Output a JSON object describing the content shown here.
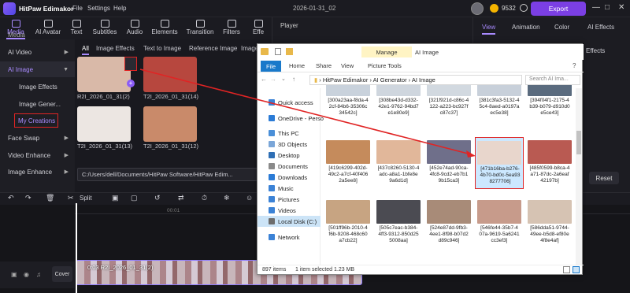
{
  "app": {
    "name": "HitPaw Edimakor",
    "menu": [
      "File",
      "Settings",
      "Help"
    ],
    "project_title": "2026-01-31_02",
    "coins": "9532",
    "export_label": "Export"
  },
  "toolbar": [
    "Media",
    "AI Avatar",
    "Text",
    "Subtitles",
    "Audio",
    "Elements",
    "Transition",
    "Filters",
    "Effe"
  ],
  "sidebar": {
    "top_partial": "Media",
    "items": [
      {
        "label": "AI Video"
      },
      {
        "label": "AI Image"
      },
      {
        "label": "Image Effects"
      },
      {
        "label": "Image Gener..."
      },
      {
        "label": "My Creations"
      },
      {
        "label": "Face Swap"
      },
      {
        "label": "Video Enhance"
      },
      {
        "label": "Image Enhance"
      }
    ]
  },
  "media": {
    "tabs": [
      "All",
      "Image Effects",
      "Text to Image",
      "Reference Image",
      "Image"
    ],
    "thumbs": [
      {
        "label": "R2I_2026_01_31(2)",
        "color": "#d9b9a8"
      },
      {
        "label": "T2I_2026_01_31(14)",
        "color": "#b7473e"
      },
      {
        "label": "T2I_2026_01_31(13)",
        "color": "#ece6e2"
      },
      {
        "label": "T2I_2026_01_31(12)",
        "color": "#c98a6a"
      }
    ],
    "path": "C:/Users/dell/Documents/HitPaw Software/HitPaw Edim..."
  },
  "player": {
    "label": "Player"
  },
  "right_panel": {
    "tabs": [
      "View",
      "Animation",
      "Color",
      "AI Effects"
    ],
    "subtab": "Effects",
    "reset_label": "Reset"
  },
  "timeline": {
    "split_label": "Split",
    "ruler_time": "00:01",
    "clip_label": "0:03 R2I_2026_01_31(2)",
    "cover_label": "Cover"
  },
  "explorer": {
    "manage_label": "Manage",
    "title": "AI Image",
    "ribbon": [
      "File",
      "Home",
      "Share",
      "View",
      "Picture Tools"
    ],
    "address": [
      "HitPaw Edimakor",
      "AI Generator",
      "AI Image"
    ],
    "search_placeholder": "Search AI Ima...",
    "nav": [
      {
        "label": "Quick access",
        "color": "#3b82d6"
      },
      {
        "label": "OneDrive - Perso",
        "color": "#2b7bd6"
      },
      {
        "label": "This PC",
        "color": "#4a8fd8"
      },
      {
        "label": "3D Objects",
        "color": "#7aa6d8"
      },
      {
        "label": "Desktop",
        "color": "#2f6fb5"
      },
      {
        "label": "Documents",
        "color": "#8a8a8a"
      },
      {
        "label": "Downloads",
        "color": "#2b7bd6"
      },
      {
        "label": "Music",
        "color": "#3b82d6"
      },
      {
        "label": "Pictures",
        "color": "#3b82d6"
      },
      {
        "label": "Videos",
        "color": "#3b82d6"
      },
      {
        "label": "Local Disk (C:)",
        "color": "#6c6c6c"
      },
      {
        "label": "Network",
        "color": "#3b82d6"
      }
    ],
    "files": [
      {
        "name": "[300a23aa-f8da-4 2cf-84b6-35306c 34542c]",
        "color": "#c9d2dc"
      },
      {
        "name": "[308be43d-d332- 42e1-9762-94bd7 e1e80e9]",
        "color": "#cfd6de"
      },
      {
        "name": "[321f921d-c86c-4 122-a223-bc927f c87c37]",
        "color": "#d2d9e0"
      },
      {
        "name": "[381c3fa3-5132-4 5c4-8aed-a0197a ec5e38]",
        "color": "#c8d0da"
      },
      {
        "name": "[394f04f1-2175-4 b39-b079-d910d0 e5ce43]",
        "color": "#5a6b7e"
      },
      {
        "name": "[419c6299-402d- 49c2-a7cf-40f406 2a5ee8]",
        "color": "#c58b5c"
      },
      {
        "name": "[437c8260-5130-4 adc-a8a1-1bfe8e 9a6d1d]",
        "color": "#e1b79a"
      },
      {
        "name": "[452e74ad-90ca- 4fc8-9cd2-eb7b1 9b15ca3]",
        "color": "#6f6f8a"
      },
      {
        "name": "[471b16ba-b276- 4b70-bd0c-5ea93 8277706]",
        "color": "#e8d6cc"
      },
      {
        "name": "[485f0599-b8ca-4 a71-87dc-2a6eaf 42197b]",
        "color": "#b95a52"
      },
      {
        "name": "[501ff96b-2010-4 f6b-9208-468c60 a7cb22]",
        "color": "#c7a482"
      },
      {
        "name": "[505c7eac-b384- 4ff3-9312-850d25 5008aa]",
        "color": "#4b4b52"
      },
      {
        "name": "[524e87dd-9fb3- 4ee1-8f98-b07d2 d89c946]",
        "color": "#a88b78"
      },
      {
        "name": "[546fe44-35b7-4 07a-9619-5a6241 cc3ef3]",
        "color": "#c79b8b"
      },
      {
        "name": "[586dda51-9744- 49ee-b5d8-ef80e 4f8e4af]",
        "color": "#d6c3b3"
      }
    ],
    "selected_index": 8,
    "status_count": "897 items",
    "status_selected": "1 item selected  1.23 MB"
  }
}
